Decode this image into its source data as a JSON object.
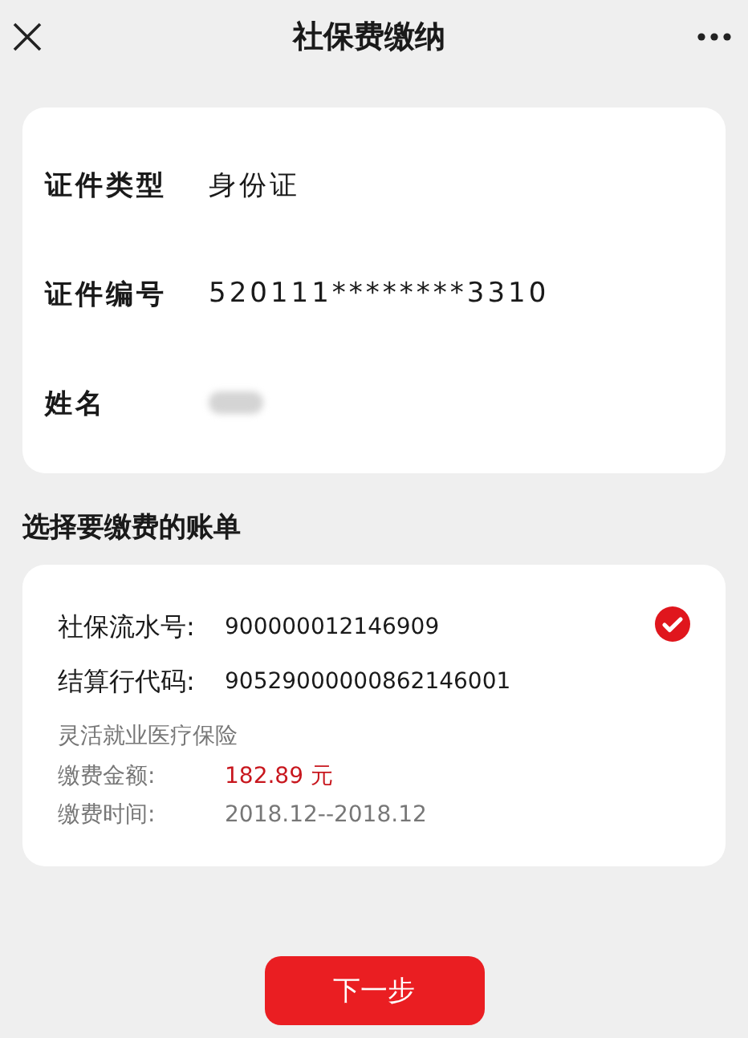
{
  "header": {
    "title": "社保费缴纳"
  },
  "identity": [
    {
      "label": "证件类型",
      "value": "身份证"
    },
    {
      "label": "证件编号",
      "value": "520111********3310"
    },
    {
      "label": "姓名",
      "kind": "blurred"
    }
  ],
  "bills_title": "选择要缴费的账单",
  "bills": [
    {
      "selected": true,
      "lines": [
        {
          "label": "社保流水号:",
          "value": "900000012146909"
        },
        {
          "label": "结算行代码:",
          "value": "90529000000862146001"
        }
      ],
      "type": "灵活就业医疗保险",
      "amount_label": "缴费金额:",
      "amount": "182.89 元",
      "period_label": "缴费时间:",
      "period": "2018.12--2018.12"
    }
  ],
  "next_button": "下一步"
}
